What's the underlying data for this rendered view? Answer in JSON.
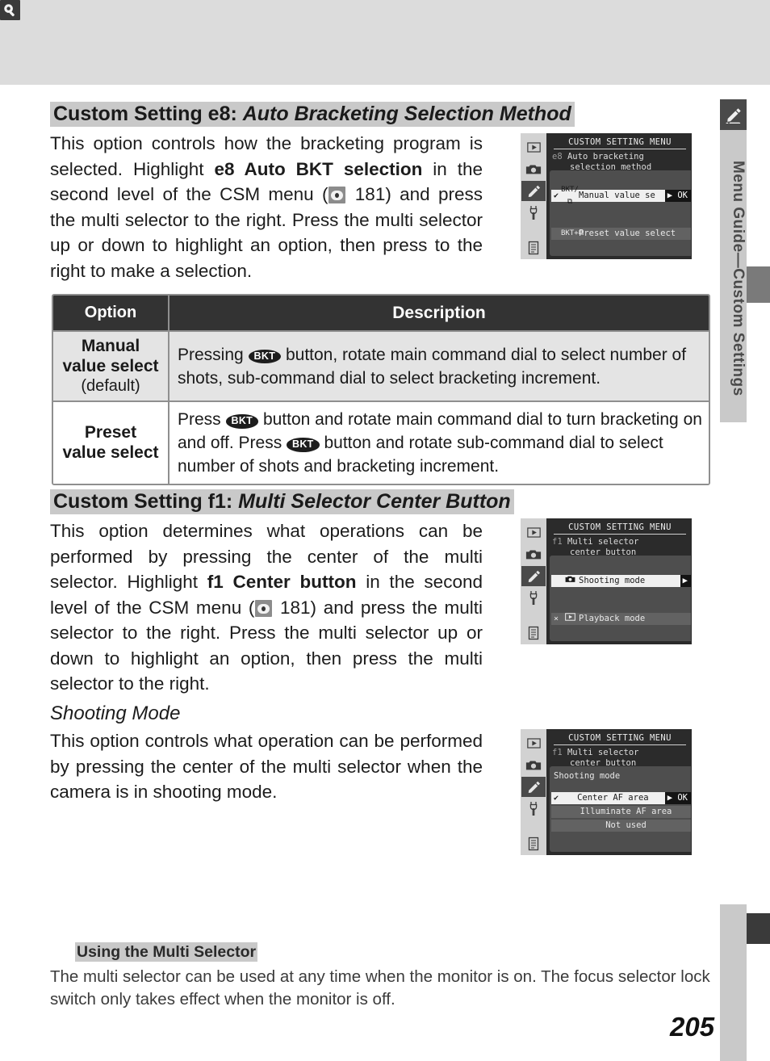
{
  "page": {
    "number": "205",
    "side_tab_label": "Menu Guide—Custom Settings",
    "side_tab_icon": "pencil-icon"
  },
  "section_e8": {
    "heading_prefix": "Custom Setting e8: ",
    "heading_title": "Auto Bracketing Selection Method",
    "body_1": "This option controls how the bracketing program is selected.  Highlight ",
    "body_bold": "e8 Auto BKT selection",
    "body_2": " in the second level of the CSM menu (",
    "ref_page": " 181) and press the multi selector to the right.  Press the multi selector up or down to highlight an option, then press to the right to make a selection.",
    "lcd": {
      "title": "CUSTOM SETTING MENU",
      "code": "e8",
      "sub_line1": "Auto bracketing",
      "sub_line2": "selection method",
      "items": [
        {
          "check": "✔",
          "icon": "BKT/⧉",
          "label": "Manual value se",
          "ok": "▶ OK",
          "state": "selected"
        },
        {
          "check": "",
          "icon": "BKT+⧉",
          "label": "Preset value select",
          "ok": "",
          "state": "dim"
        }
      ]
    }
  },
  "table": {
    "headers": [
      "Option",
      "Description"
    ],
    "rows": [
      {
        "option_bold_1": "Manual",
        "option_bold_2": "value select",
        "option_note": "(default)",
        "desc_parts": [
          "Pressing ",
          "BKT",
          " button, rotate main command dial to select number of shots, sub-command dial to select bracketing increment."
        ],
        "shade": "shaded"
      },
      {
        "option_bold_1": "Preset",
        "option_bold_2": "value select",
        "option_note": "",
        "desc_parts": [
          "Press ",
          "BKT",
          " button and rotate main command dial to turn bracketing on and off.  Press ",
          "BKT",
          " button and rotate sub-command dial to select number of shots and bracketing increment."
        ],
        "shade": "white"
      }
    ]
  },
  "section_f1": {
    "heading_prefix": "Custom Setting f1: ",
    "heading_title": "Multi Selector Center Button",
    "body_1": "This option determines what operations can be performed by pressing the center of the multi selector.  Highlight ",
    "body_bold": "f1 Center button",
    "body_2": " in the second level of the CSM menu (",
    "ref_page": " 181) and press the multi selector to the right.  Press the multi selector up or down to highlight an option, then press the multi selector to the right.",
    "lcd": {
      "title": "CUSTOM SETTING MENU",
      "code": "f1",
      "sub_line1": "Multi selector",
      "sub_line2": "center button",
      "items": [
        {
          "check": "",
          "icon": "camera-icon",
          "label": "Shooting mode",
          "ok": "▶",
          "state": "selected"
        },
        {
          "check": "×",
          "icon": "play-icon",
          "label": "Playback mode",
          "ok": "",
          "state": "dim"
        }
      ]
    }
  },
  "subsection_shooting": {
    "heading": "Shooting Mode",
    "body": "This option controls what operation can be performed by pressing the center of the multi selector when the camera is in shooting mode.",
    "lcd": {
      "title": "CUSTOM SETTING MENU",
      "code": "f1",
      "sub_line1": "Multi selector",
      "sub_line2": "center button",
      "panel_title": "Shooting mode",
      "items": [
        {
          "check": "✔",
          "label": "Center AF area",
          "ok": "▶ OK",
          "state": "selected"
        },
        {
          "check": "",
          "label": "Illuminate AF area",
          "ok": "",
          "state": "dim"
        },
        {
          "check": "",
          "label": "Not used",
          "ok": "",
          "state": "dim"
        }
      ]
    }
  },
  "note": {
    "icon": "magnifier-icon",
    "heading": "Using the Multi Selector",
    "body": "The multi selector can be used at any time when the monitor is on.  The focus selector lock switch only takes effect when the monitor is off."
  }
}
